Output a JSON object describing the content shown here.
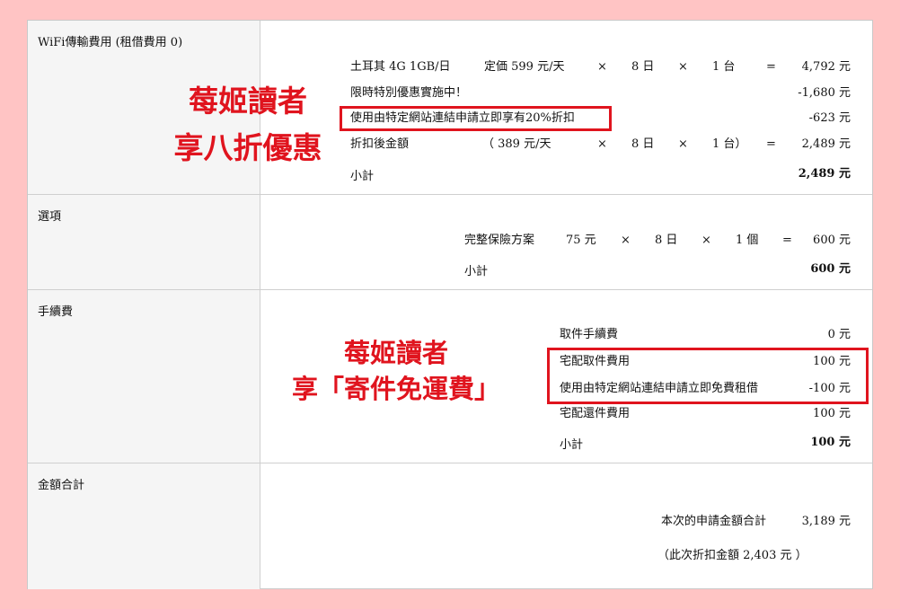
{
  "wifi": {
    "label": "WiFi傳輸費用 (租借費用 0)",
    "row1": {
      "item": "土耳其 4G 1GB/日",
      "unit": "定価 599 元/天",
      "x1": "×",
      "days": "8 日",
      "x2": "×",
      "qty": "1 台",
      "eq": "=",
      "amount": "4,792 元"
    },
    "row2": {
      "item": "限時特別優惠實施中！",
      "amount": "-1,680 元"
    },
    "row3": {
      "item": "使用由特定網站連結申請立即享有20%折扣",
      "amount": "-623 元"
    },
    "row4": {
      "item": "折扣後金額",
      "unit": "（ 389 元/天",
      "x1": "×",
      "days": "8 日",
      "x2": "×",
      "qty": "1 台）",
      "eq": "=",
      "amount": "2,489 元"
    },
    "subtotal_label": "小計",
    "subtotal": "2,489 元",
    "promo_line1": "莓姬讀者",
    "promo_line2": "享八折優惠"
  },
  "options": {
    "label": "選項",
    "row1": {
      "item": "完整保險方案",
      "unit": "75 元",
      "x1": "×",
      "days": "8 日",
      "x2": "×",
      "qty": "1 個",
      "eq": "=",
      "amount": "600 元"
    },
    "subtotal_label": "小計",
    "subtotal": "600 元"
  },
  "fees": {
    "label": "手續費",
    "rows": [
      {
        "item": "取件手續費",
        "amount": "0 元"
      },
      {
        "item": "宅配取件費用",
        "amount": "100 元"
      },
      {
        "item": "使用由特定網站連結申請立即免費租借",
        "amount": "-100 元"
      },
      {
        "item": "宅配還件費用",
        "amount": "100 元"
      }
    ],
    "subtotal_label": "小計",
    "subtotal": "100 元",
    "promo_line1": "莓姬讀者",
    "promo_line2": "享「寄件免運費」"
  },
  "total": {
    "label": "金額合計",
    "total_label": "本次的申請金額合計",
    "total_value": "3,189 元",
    "discount_note": "（此次折扣金額 2,403 元 ）"
  },
  "colors": {
    "accent_red": "#e0141e",
    "page_bg": "#ffc4c4",
    "label_bg": "#f5f5f5"
  }
}
